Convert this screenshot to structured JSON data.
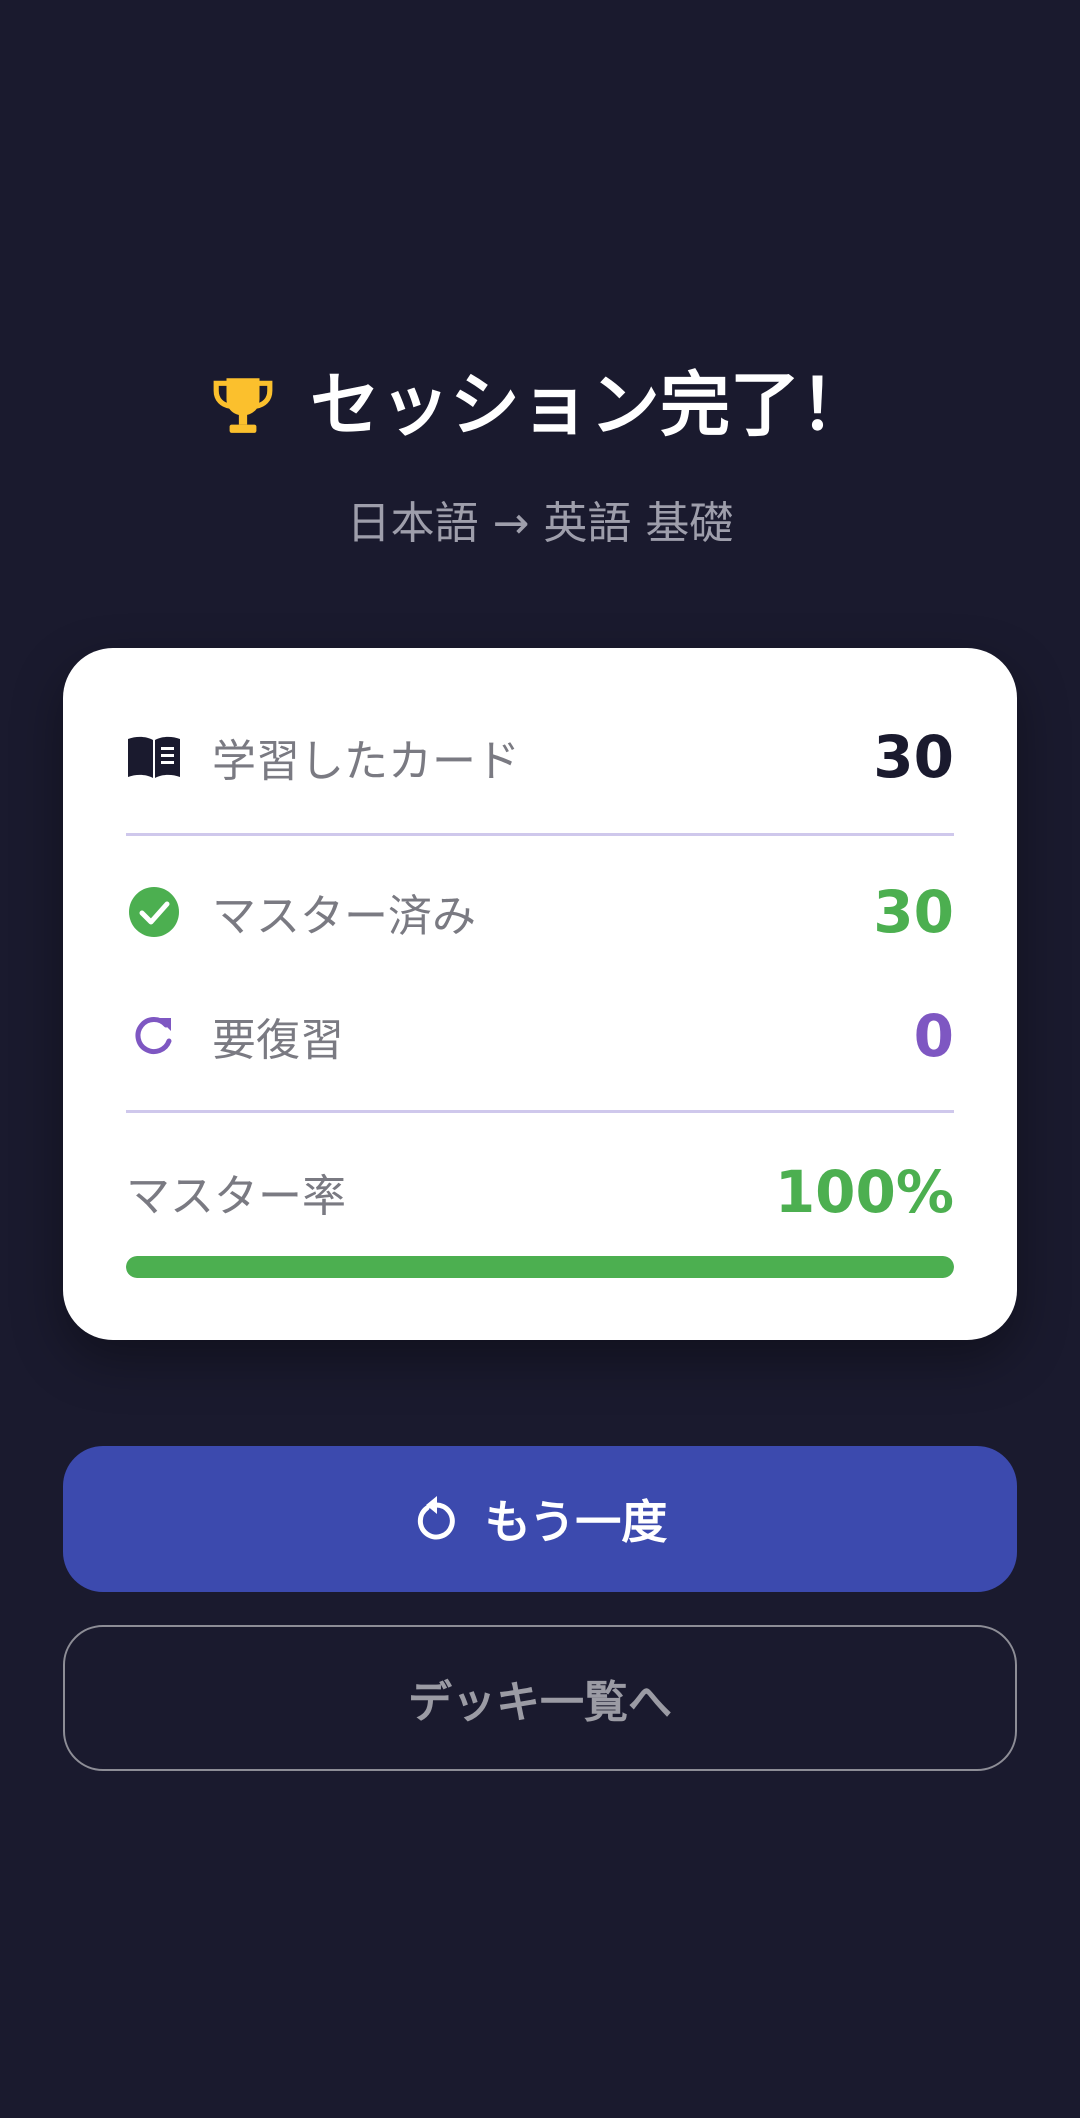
{
  "header": {
    "icon": "trophy-icon",
    "title": "セッション完了！",
    "subtitle": "日本語 → 英語 基礎"
  },
  "stats": {
    "studied": {
      "icon": "book-icon",
      "label": "学習したカード",
      "value": "30"
    },
    "mastered": {
      "icon": "check-circle-icon",
      "label": "マスター済み",
      "value": "30"
    },
    "review": {
      "icon": "refresh-icon",
      "label": "要復習",
      "value": "0"
    },
    "mastery": {
      "label": "マスター率",
      "value": "100%",
      "progress": 1.0
    }
  },
  "actions": {
    "retry": {
      "icon": "replay-icon",
      "label": "もう一度"
    },
    "deck_list": {
      "label": "デッキ一覧へ"
    }
  },
  "colors": {
    "background": "#1a1a2e",
    "card": "#ffffff",
    "accent_green": "#4caf50",
    "accent_purple": "#7e57c2",
    "primary_button": "#3c4aae",
    "trophy": "#fbc02d"
  }
}
